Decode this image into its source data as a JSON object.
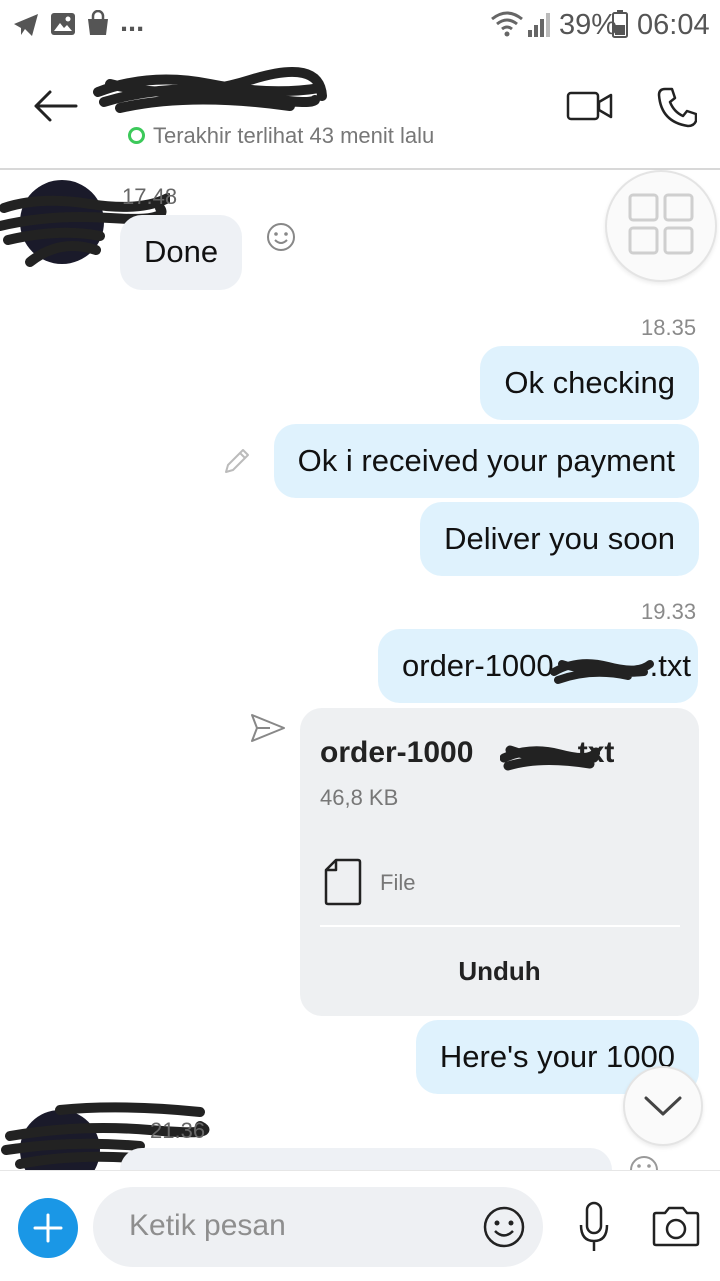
{
  "status_bar": {
    "left_icons": [
      "telegram-icon",
      "gallery-icon",
      "shopping-bag-icon"
    ],
    "more_dots": "...",
    "battery_percent": "39%",
    "time": "06:04"
  },
  "header": {
    "presence_text": "Terakhir terlihat 43 menit lalu",
    "presence_color": "#3cc95a"
  },
  "messages": {
    "in_1": {
      "time": "17.48",
      "text": "Done"
    },
    "out_group_1": {
      "time": "18.35",
      "items": [
        "Ok checking",
        "Ok i received your payment",
        "Deliver you soon"
      ]
    },
    "out_group_2": {
      "time": "19.33",
      "file_message": "order-1000",
      "file_suffix": ".txt"
    },
    "file_card": {
      "name_prefix": "order-1000",
      "name_suffix": ".txt",
      "size": "46,8 KB",
      "type_label": "File",
      "download_label": "Unduh"
    },
    "out_3": {
      "text": "Here's your 1000"
    },
    "in_2": {
      "time": "21.36"
    }
  },
  "composer": {
    "placeholder": "Ketik pesan"
  },
  "colors": {
    "accent": "#1a97e6",
    "outgoing_bubble": "#dff2fd",
    "incoming_bubble": "#eef1f5"
  }
}
